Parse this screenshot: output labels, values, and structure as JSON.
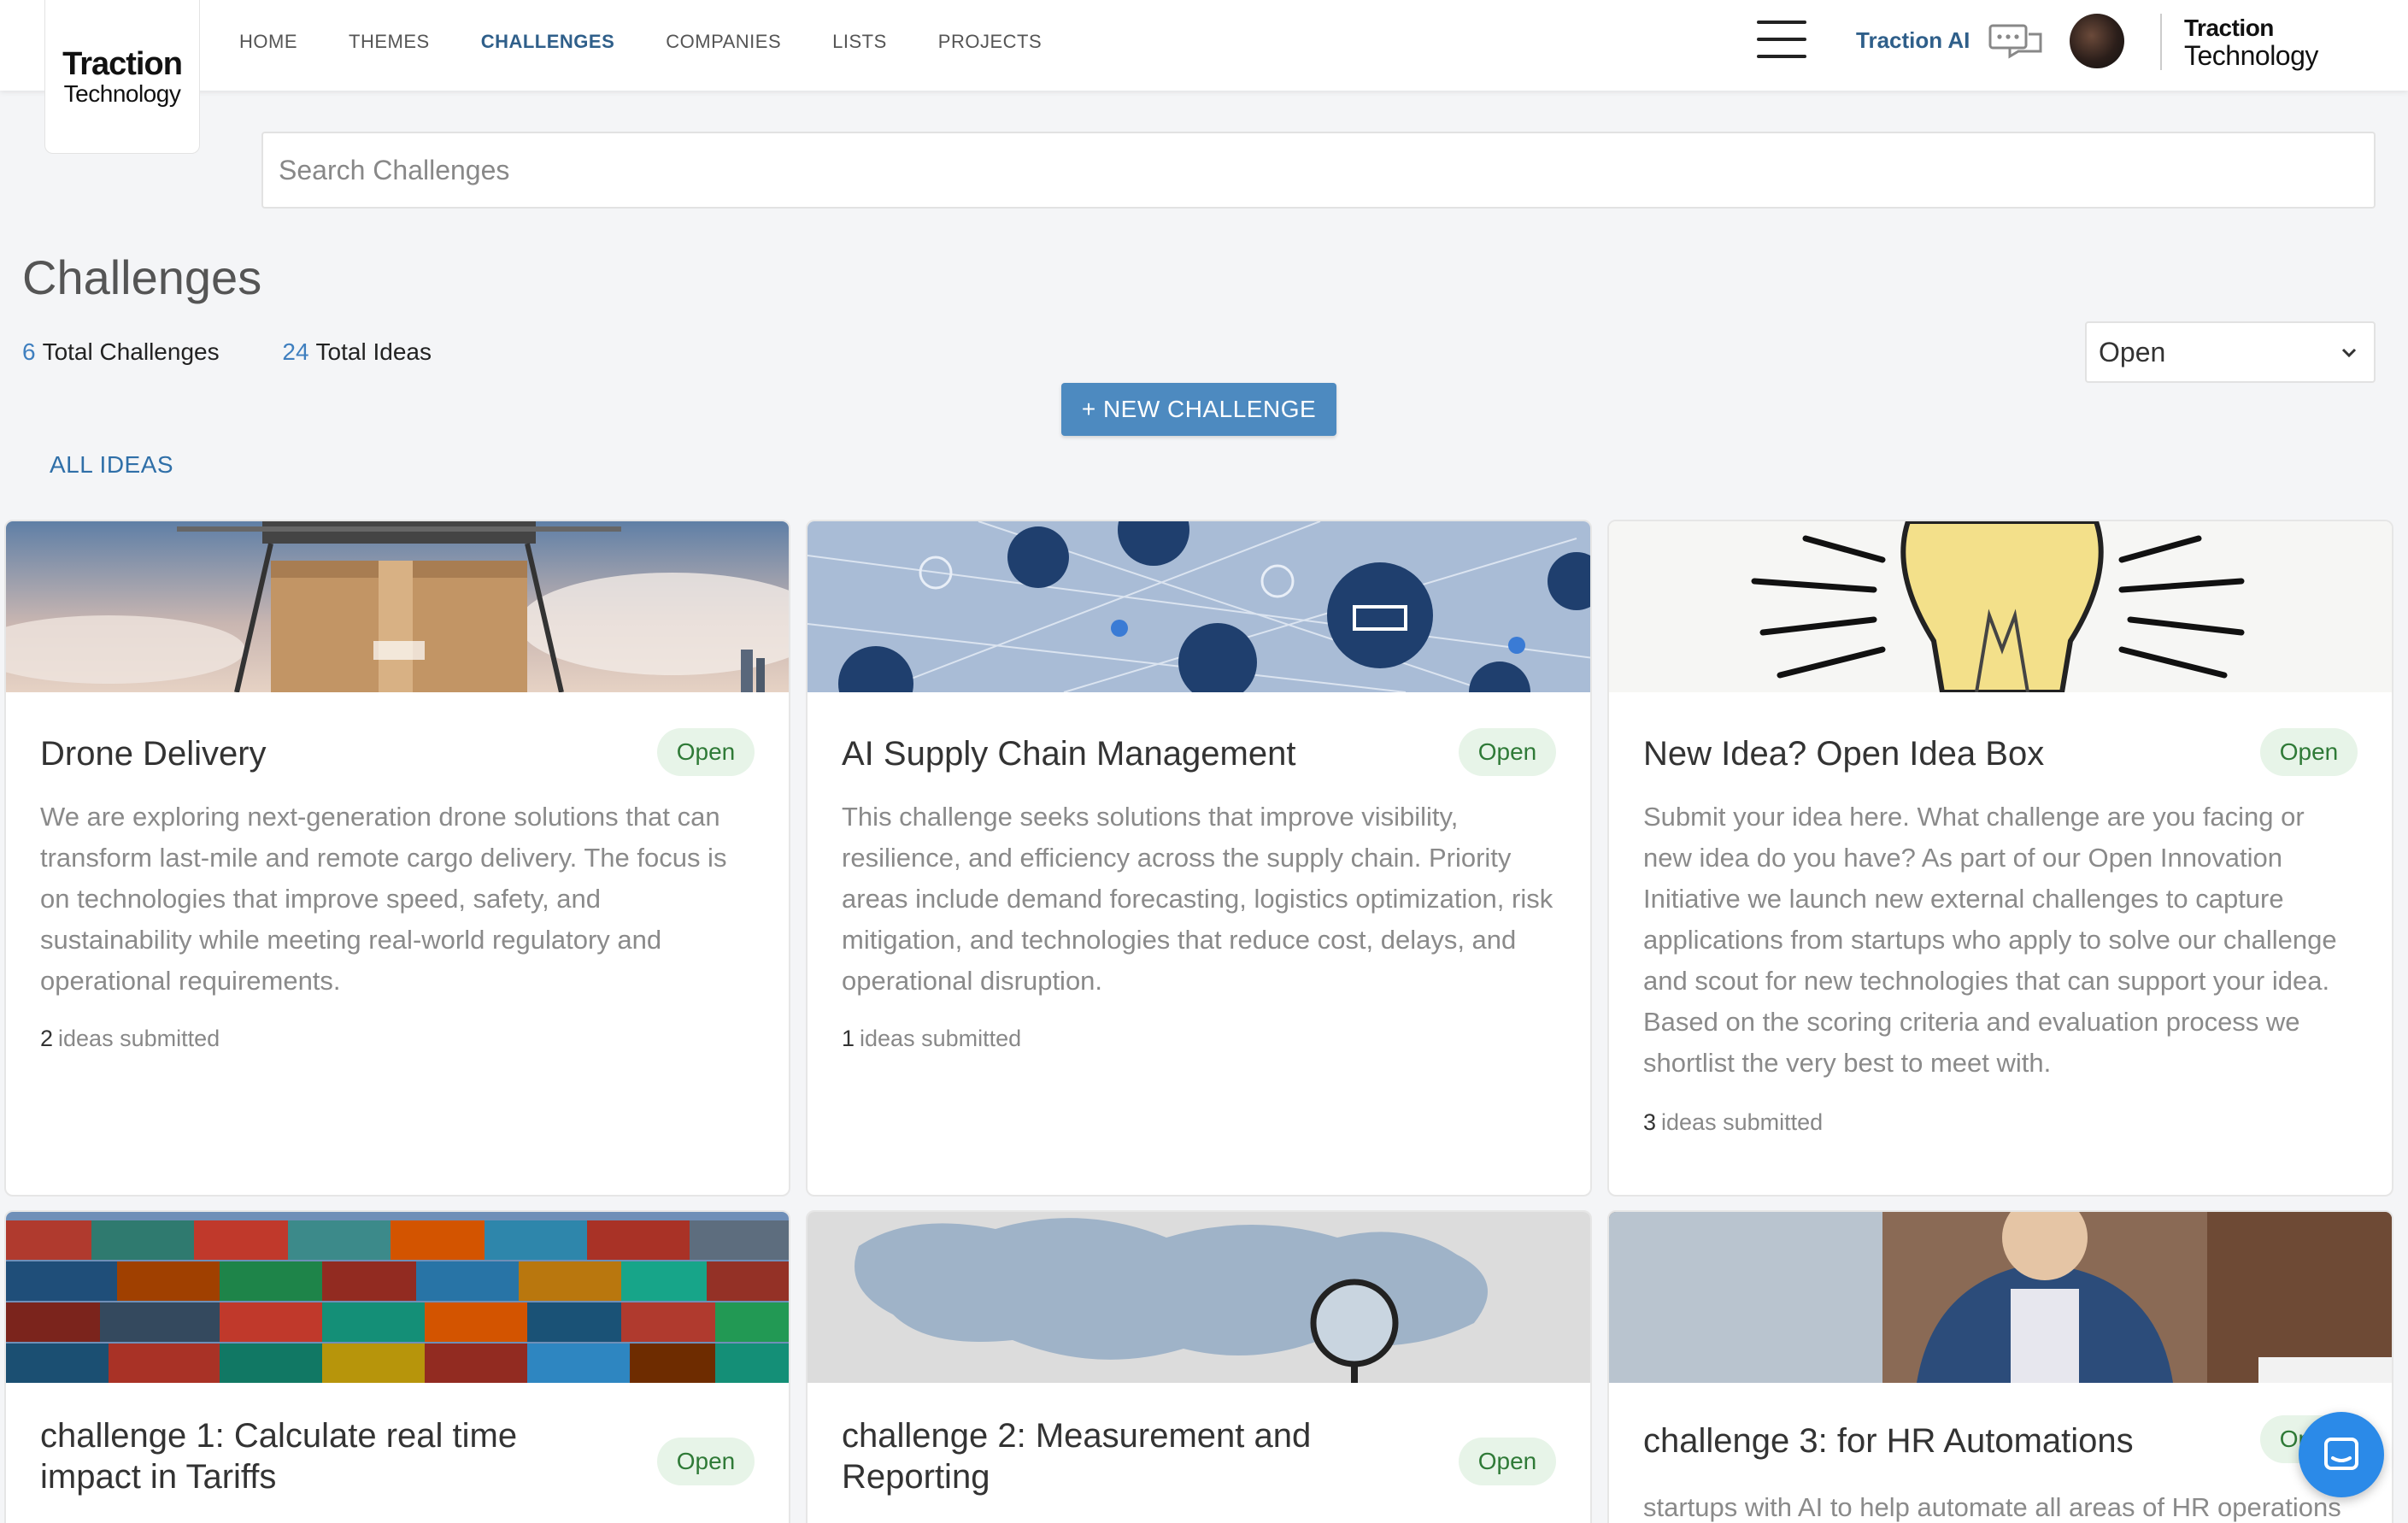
{
  "brand": {
    "line1": "Traction",
    "line2": "Technology"
  },
  "nav": [
    {
      "label": "HOME",
      "active": false
    },
    {
      "label": "THEMES",
      "active": false
    },
    {
      "label": "CHALLENGES",
      "active": true
    },
    {
      "label": "COMPANIES",
      "active": false
    },
    {
      "label": "LISTS",
      "active": false
    },
    {
      "label": "PROJECTS",
      "active": false
    }
  ],
  "header": {
    "traction_ai": "Traction AI",
    "right_logo_line1": "Traction",
    "right_logo_line2": "Technology"
  },
  "search": {
    "placeholder": "Search Challenges"
  },
  "page": {
    "title": "Challenges",
    "total_challenges_num": "6",
    "total_challenges_label": "Total Challenges",
    "total_ideas_num": "24",
    "total_ideas_label": "Total Ideas",
    "status_filter": "Open",
    "new_button": "+ NEW CHALLENGE",
    "all_ideas": "ALL IDEAS"
  },
  "cards": [
    {
      "title": "Drone Delivery",
      "status": "Open",
      "description": "We are exploring next-generation drone solutions that can transform last-mile and remote cargo delivery. The focus is on technologies that improve speed, safety, and sustainability while meeting real-world regulatory and operational requirements.",
      "ideas_count": "2",
      "ideas_label": "ideas submitted"
    },
    {
      "title": "AI Supply Chain Management",
      "status": "Open",
      "description": "This challenge seeks solutions that improve visibility, resilience, and efficiency across the supply chain. Priority areas include demand forecasting, logistics optimization, risk mitigation, and technologies that reduce cost, delays, and operational disruption.",
      "ideas_count": "1",
      "ideas_label": "ideas submitted"
    },
    {
      "title": "New Idea? Open Idea Box",
      "status": "Open",
      "description": "Submit your idea here. What challenge are you facing or new idea do you have? As part of our Open Innovation Initiative we launch new external challenges to capture applications from startups who apply to solve our challenge and scout for new technologies that can support your idea. Based on the scoring criteria and evaluation process we shortlist the very best to meet with.",
      "ideas_count": "3",
      "ideas_label": "ideas submitted"
    },
    {
      "title": "challenge 1: Calculate real time impact in Tariffs",
      "status": "Open"
    },
    {
      "title": "challenge 2: Measurement and Reporting",
      "status": "Open"
    },
    {
      "title": "challenge 3: for HR Automations",
      "status": "Open",
      "description": "startups with AI to help automate all areas of HR operations"
    }
  ]
}
